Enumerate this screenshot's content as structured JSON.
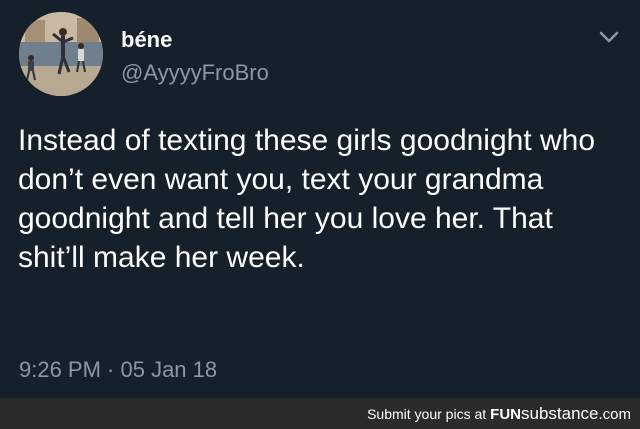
{
  "tweet": {
    "display_name": "béne",
    "handle": "@AyyyyFroBro",
    "text": "Instead of texting these girls goodnight who don’t even want you, text your grandma goodnight and tell her you love her. That shit’ll make her week.",
    "timestamp": "9:26 PM · 05 Jan 18",
    "avatar_icon": "profile-photo",
    "menu_icon": "chevron-down-icon"
  },
  "footer": {
    "prefix": "Submit your pics at",
    "brand_fun": "FUN",
    "brand_sub": "substance",
    "brand_tld": ".com"
  },
  "colors": {
    "background": "#15202b",
    "primary_text": "#ffffff",
    "secondary_text": "#8899a6",
    "footer_background": "#2b2b2b"
  }
}
